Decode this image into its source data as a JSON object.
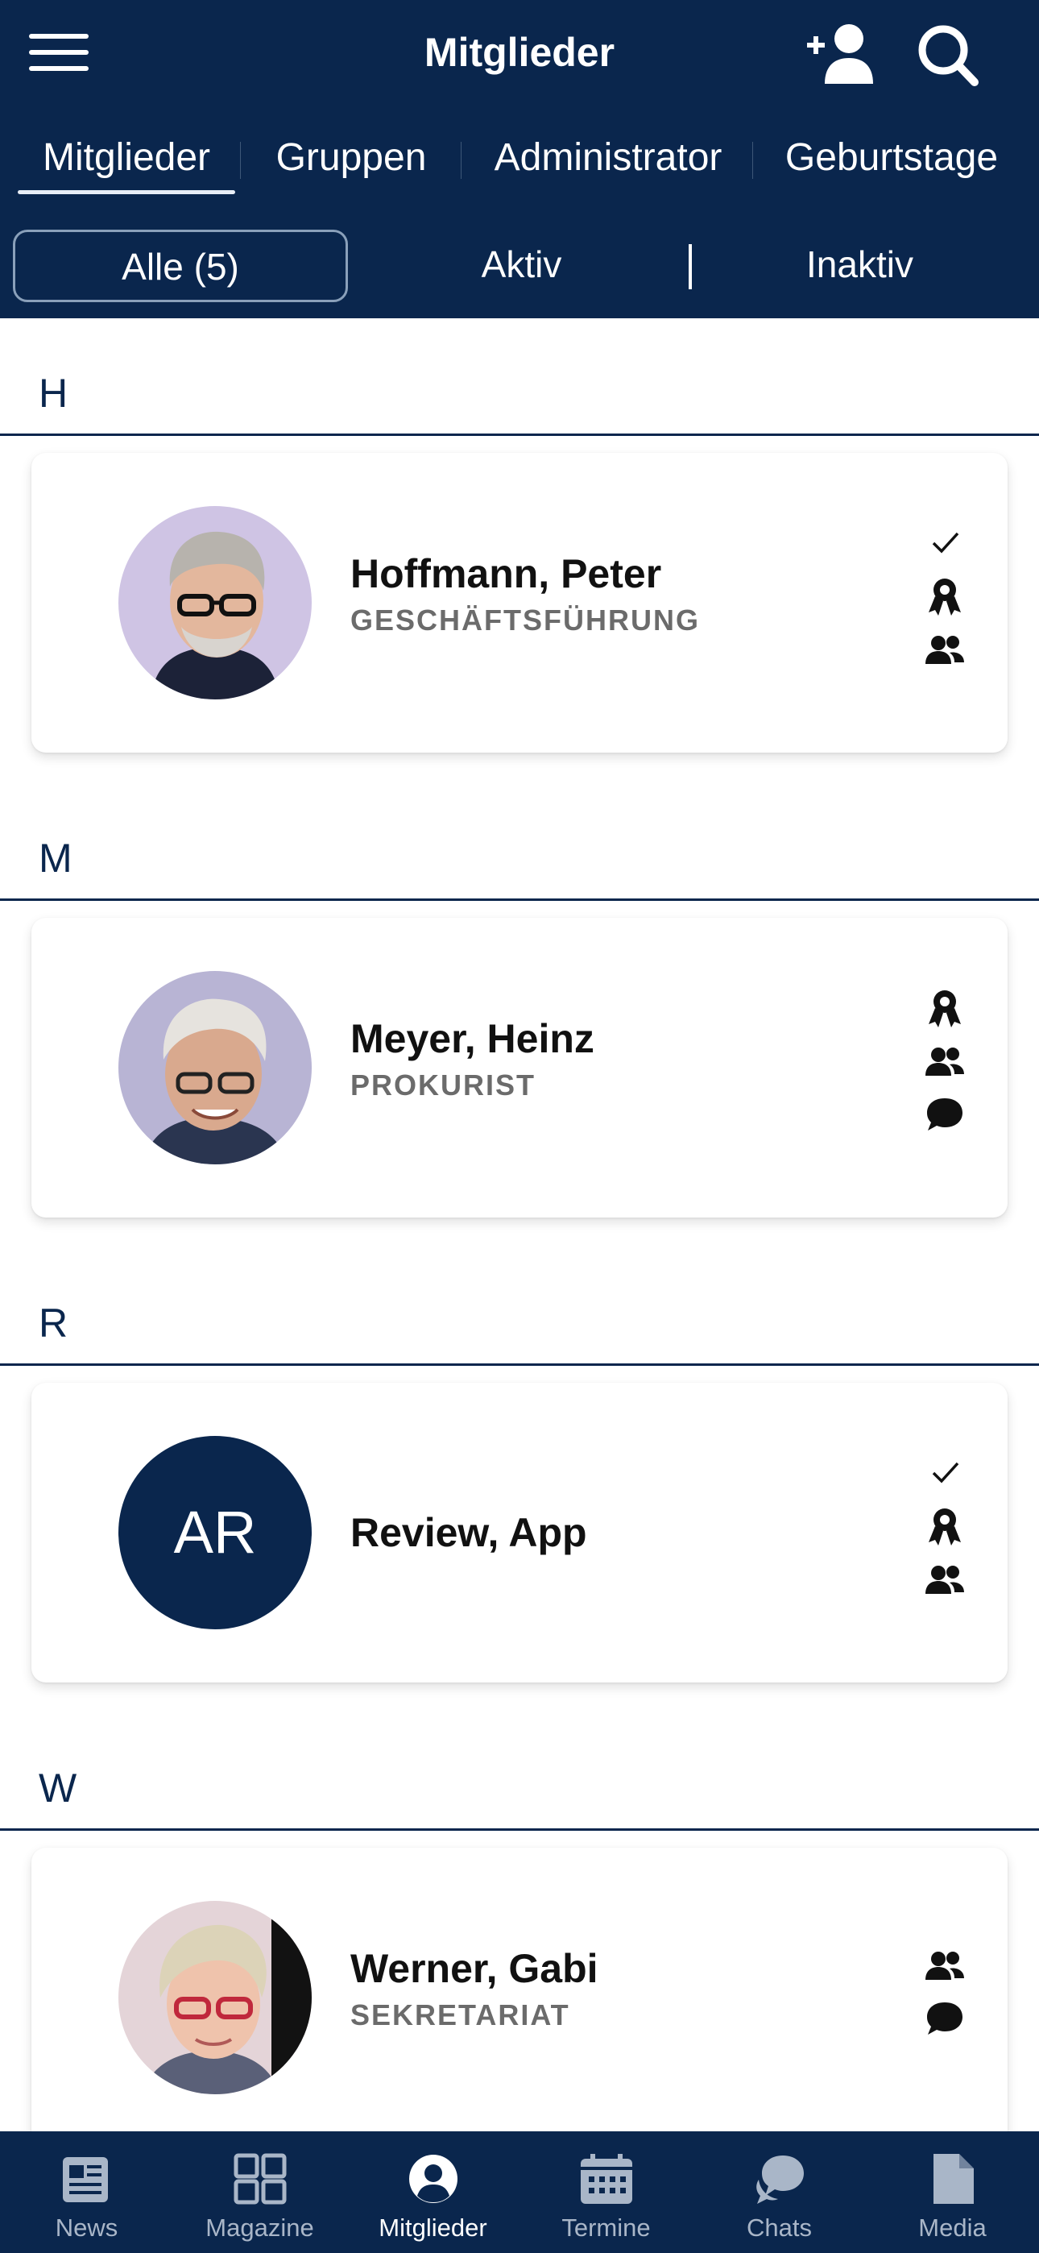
{
  "header": {
    "title": "Mitglieder",
    "tabs": [
      {
        "label": "Mitglieder",
        "active": true
      },
      {
        "label": "Gruppen",
        "active": false
      },
      {
        "label": "Administrator",
        "active": false
      },
      {
        "label": "Geburtstage",
        "active": false
      }
    ],
    "filters": [
      {
        "label": "Alle (5)",
        "active": true
      },
      {
        "label": "Aktiv",
        "active": false
      },
      {
        "label": "Inaktiv",
        "active": false
      }
    ]
  },
  "sections": [
    {
      "letter": "H",
      "member": {
        "name": "Hoffmann, Peter",
        "role": "GESCHÄFTSFÜHRUNG",
        "avatar": "photo",
        "status_icons": [
          "check-icon",
          "award-icon",
          "group-icon"
        ]
      }
    },
    {
      "letter": "M",
      "member": {
        "name": "Meyer, Heinz",
        "role": "PROKURIST",
        "avatar": "photo",
        "status_icons": [
          "award-icon",
          "group-icon",
          "chat-icon"
        ]
      }
    },
    {
      "letter": "R",
      "member": {
        "name": "Review, App",
        "role": "",
        "avatar_initials": "AR",
        "status_icons": [
          "check-icon",
          "award-icon",
          "group-icon"
        ]
      }
    },
    {
      "letter": "W",
      "member": {
        "name": "Werner, Gabi",
        "role": "SEKRETARIAT",
        "avatar": "photo",
        "status_icons": [
          "group-icon",
          "chat-icon"
        ]
      }
    }
  ],
  "bottom_nav": [
    {
      "label": "News",
      "icon": "newspaper-icon",
      "active": false
    },
    {
      "label": "Magazine",
      "icon": "grid-icon",
      "active": false
    },
    {
      "label": "Mitglieder",
      "icon": "user-circle-icon",
      "active": true
    },
    {
      "label": "Termine",
      "icon": "calendar-icon",
      "active": false
    },
    {
      "label": "Chats",
      "icon": "chat-bubbles-icon",
      "active": false
    },
    {
      "label": "Media",
      "icon": "file-icon",
      "active": false
    }
  ],
  "colors": {
    "primary": "#0a264d",
    "nav_inactive": "#a9b6c8",
    "role_text": "#6b6b6b"
  }
}
